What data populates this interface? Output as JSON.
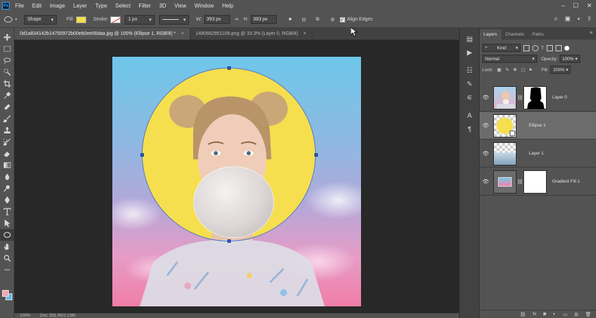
{
  "app": {
    "logo": "Ps"
  },
  "menu": [
    "File",
    "Edit",
    "Image",
    "Layer",
    "Type",
    "Select",
    "Filter",
    "3D",
    "View",
    "Window",
    "Help"
  ],
  "window_controls": [
    "minimize-icon",
    "maximize-icon",
    "close-icon"
  ],
  "options": {
    "tool_mode": "Shape",
    "fill_label": "Fill:",
    "stroke_label": "Stroke:",
    "stroke_width": "1 px",
    "width_label": "W:",
    "width_value": "393 px",
    "height_label": "H:",
    "height_value": "393 px",
    "align_edges_label": "Align Edges",
    "align_edges_checked": true,
    "fill_color": "#f5df4e",
    "stroke_color": "#e0262a"
  },
  "tabs": [
    {
      "label": "0d1a834142b14700972b00eb0ee56daa.jpg @ 100% (Ellipse 1, RGB/8) *",
      "active": true
    },
    {
      "label": "1480662951109.png @ 33.3% (Layer 0, RGB/8)",
      "active": false
    }
  ],
  "tools": [
    "move-icon",
    "marquee-icon",
    "lasso-icon",
    "quick-select-icon",
    "crop-icon",
    "eyedropper-icon",
    "healing-icon",
    "brush-icon",
    "clone-stamp-icon",
    "history-brush-icon",
    "eraser-icon",
    "gradient-icon",
    "blur-icon",
    "dodge-icon",
    "pen-icon",
    "type-icon",
    "path-select-icon",
    "ellipse-icon",
    "hand-icon",
    "zoom-icon",
    "more-icon"
  ],
  "colors": {
    "foreground": "#f0a6b8",
    "background": "#65b7e3"
  },
  "layers_panel": {
    "tabs": [
      "Layers",
      "Channels",
      "Paths"
    ],
    "filter_kind": "Kind",
    "blend_mode": "Normal",
    "opacity_label": "Opacity:",
    "opacity_value": "100%",
    "lock_label": "Lock:",
    "fill_label": "Fill:",
    "fill_value": "100%",
    "layers": [
      {
        "name": "Layer 0",
        "selected": false,
        "has_mask": true
      },
      {
        "name": "Ellipse 1",
        "selected": true,
        "has_mask": false
      },
      {
        "name": "Layer 1",
        "selected": false,
        "has_mask": false
      },
      {
        "name": "Gradient Fill 1",
        "selected": false,
        "has_mask": true
      }
    ]
  },
  "status": {
    "zoom": "100%",
    "doc": "Doc: 931.9K/2.13M"
  }
}
